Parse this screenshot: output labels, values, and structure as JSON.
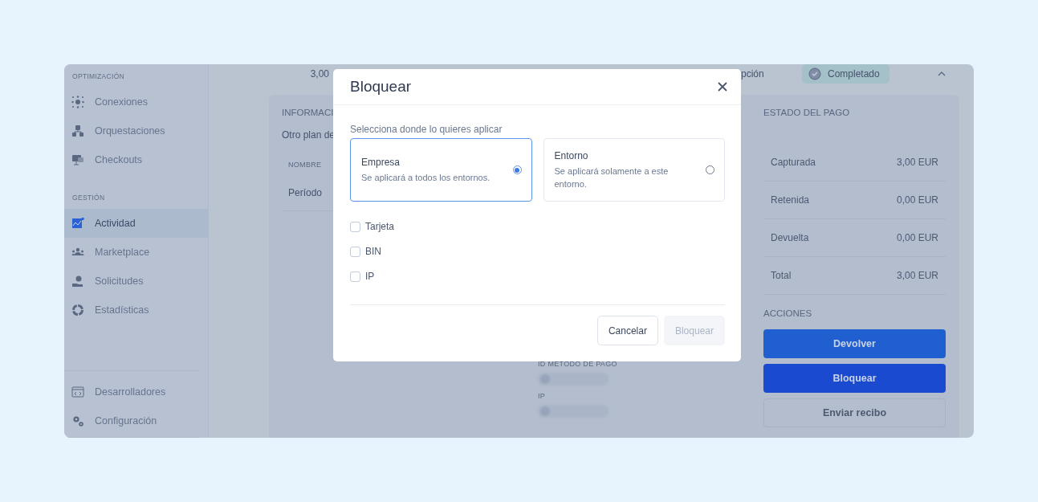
{
  "sidebar": {
    "sections": [
      {
        "title": "OPTIMIZACIÓN",
        "items": [
          {
            "label": "Conexiones",
            "selected": false
          },
          {
            "label": "Orquestaciones",
            "selected": false
          },
          {
            "label": "Checkouts",
            "selected": false
          }
        ]
      },
      {
        "title": "GESTIÓN",
        "items": [
          {
            "label": "Actividad",
            "selected": true
          },
          {
            "label": "Marketplace",
            "selected": false
          },
          {
            "label": "Solicitudes",
            "selected": false
          },
          {
            "label": "Estadísticas",
            "selected": false
          }
        ]
      }
    ],
    "footer_items": [
      {
        "label": "Desarrolladores",
        "selected": false
      },
      {
        "label": "Configuración",
        "selected": false
      }
    ]
  },
  "top_row": {
    "amount": "3,00",
    "type": "pción",
    "status": "Completado"
  },
  "info_panel": {
    "title": "INFORMACI",
    "subtitle": "Otro plan de",
    "column": "NOMBRE",
    "row": "Período"
  },
  "details": [
    {
      "label": "ID MÉTODO DE PAGO"
    },
    {
      "label": "IP"
    }
  ],
  "payment_status": {
    "title": "ESTADO DEL PAGO",
    "rows": [
      {
        "label": "Capturada",
        "value": "3,00 EUR"
      },
      {
        "label": "Retenida",
        "value": "0,00 EUR"
      },
      {
        "label": "Devuelta",
        "value": "0,00 EUR"
      },
      {
        "label": "Total",
        "value": "3,00 EUR"
      }
    ]
  },
  "actions": {
    "title": "ACCIONES",
    "buttons": [
      {
        "label": "Devolver",
        "kind": "primary"
      },
      {
        "label": "Bloquear",
        "kind": "strong"
      },
      {
        "label": "Enviar recibo",
        "kind": "outline"
      }
    ]
  },
  "dialog": {
    "title": "Bloquear",
    "prompt": "Selecciona donde lo quieres aplicar",
    "options": [
      {
        "title": "Empresa",
        "description": "Se aplicará a todos los entornos.",
        "selected": true
      },
      {
        "title": "Entorno",
        "description": "Se aplicará solamente a este entorno.",
        "selected": false
      }
    ],
    "checkboxes": [
      {
        "label": "Tarjeta",
        "checked": false
      },
      {
        "label": "BIN",
        "checked": false
      },
      {
        "label": "IP",
        "checked": false
      }
    ],
    "buttons": [
      {
        "label": "Cancelar",
        "disabled": false
      },
      {
        "label": "Bloquear",
        "disabled": true
      }
    ]
  }
}
